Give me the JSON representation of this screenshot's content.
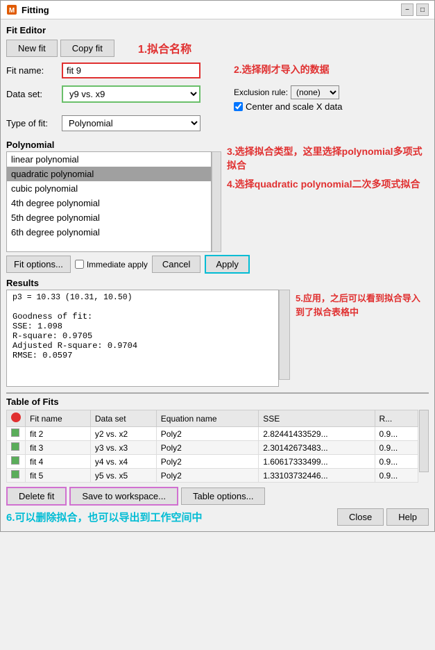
{
  "window": {
    "title": "Fitting",
    "minimize": "−",
    "maximize": "□",
    "close": "✕"
  },
  "fit_editor": {
    "section_label": "Fit Editor",
    "new_btn": "New fit",
    "copy_btn": "Copy fit",
    "fit_name_label": "Fit name:",
    "fit_name_value": "fit 9",
    "data_set_label": "Data set:",
    "data_set_value": "y9 vs. x9",
    "exclusion_label": "Exclusion rule:",
    "exclusion_value": "(none)",
    "center_scale_label": "Center and scale X data",
    "type_of_fit_label": "Type of fit:",
    "type_of_fit_value": "Polynomial",
    "polynomial_label": "Polynomial",
    "poly_items": [
      "linear polynomial",
      "quadratic polynomial",
      "cubic polynomial",
      "4th degree polynomial",
      "5th degree polynomial",
      "6th degree polynomial"
    ],
    "selected_poly": "quadratic polynomial",
    "fit_options_btn": "Fit options...",
    "immediate_apply_label": "Immediate apply",
    "cancel_btn": "Cancel",
    "apply_btn": "Apply"
  },
  "results": {
    "section_label": "Results",
    "content_lines": [
      "   p3 =      10.33  (10.31, 10.50)",
      "",
      "Goodness of fit:",
      "  SSE: 1.098",
      "  R-square: 0.9705",
      "  Adjusted R-square: 0.9704",
      "  RMSE: 0.0597"
    ]
  },
  "table_of_fits": {
    "section_label": "Table of Fits",
    "columns": [
      "",
      "Fit name",
      "Data set",
      "Equation name",
      "SSE",
      "R..."
    ],
    "rows": [
      {
        "color": "#5aad5a",
        "fit_name": "fit 2",
        "data_set": "y2 vs. x2",
        "equation": "Poly2",
        "sse": "2.82441433529...",
        "r": "0.9..."
      },
      {
        "color": "#5aad5a",
        "fit_name": "fit 3",
        "data_set": "y3 vs. x3",
        "equation": "Poly2",
        "sse": "2.30142673483...",
        "r": "0.9..."
      },
      {
        "color": "#5aad5a",
        "fit_name": "fit 4",
        "data_set": "y4 vs. x4",
        "equation": "Poly2",
        "sse": "1.60617333499...",
        "r": "0.9..."
      },
      {
        "color": "#5aad5a",
        "fit_name": "fit 5",
        "data_set": "y5 vs. x5",
        "equation": "Poly2",
        "sse": "1.33103732446...",
        "r": "0.9..."
      }
    ],
    "delete_btn": "Delete fit",
    "save_btn": "Save to workspace...",
    "table_options_btn": "Table options..."
  },
  "annotations": {
    "ann1": "1.拟合名称",
    "ann2": "2.选择刚才导入的数据",
    "ann3": "3.选择拟合类型，这里选择polynomial多项式拟合",
    "ann4": "4.选择quadratic polynomial二次多项式拟合",
    "ann5": "5.应用，之后可以看到拟合导入到了拟合表格中",
    "ann6": "6.可以删除拟合，也可以导出到工作空间中"
  },
  "bottom_bar": {
    "close_btn": "Close",
    "help_btn": "Help"
  }
}
